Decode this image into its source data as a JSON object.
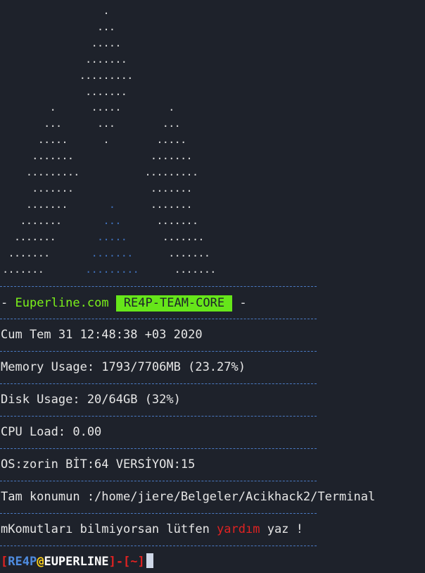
{
  "ascii_art": {
    "lines": [
      [
        "                 ."
      ],
      [
        "                ..."
      ],
      [
        "               ....."
      ],
      [
        "              ......."
      ],
      [
        "             ........."
      ],
      [
        "              ......."
      ],
      [
        "        .      .....        ."
      ],
      [
        "       ...      ...        ..."
      ],
      [
        "      .....      .        ....."
      ],
      [
        "     .......             ......."
      ],
      [
        "    .........           ........."
      ],
      [
        "     .......             ......."
      ],
      [
        "    .......",
        "       .",
        "      ......."
      ],
      [
        "   .......",
        "       ...",
        "      ......."
      ],
      [
        "  .......",
        "       .....",
        "      ......."
      ],
      [
        " .......",
        "       .......",
        "      ......."
      ],
      [
        ".......",
        "       .........",
        "      ......."
      ]
    ]
  },
  "banner": {
    "left_dash": "-",
    "site": "Euperline.com",
    "team": "RE4P-TEAM-CORE",
    "right_dash": "-"
  },
  "info": {
    "date": "Cum Tem 31 12:48:38 +03 2020",
    "memory": "Memory Usage: 1793/7706MB (23.27%)",
    "disk": "Disk Usage: 20/64GB (32%)",
    "cpu": "CPU Load: 0.00",
    "os": "OS:zorin BİT:64 VERSİYON:15",
    "location": "Tam konumun :/home/jiere/Belgeler/Acikhack2/Terminal"
  },
  "help": {
    "prefix": "mKomutları bilmiyorsan lütfen ",
    "keyword": "yardım",
    "suffix": " yaz !"
  },
  "prompt": {
    "open": "[",
    "user": "RE4P",
    "at": "@",
    "host": "EUPERLINE",
    "mid": "]-[",
    "dir": "~",
    "close": "]"
  },
  "colors": {
    "background": "#1e222b",
    "separator": "#4a79c2",
    "green_accent": "#66e61a",
    "red_accent": "#e02222"
  }
}
